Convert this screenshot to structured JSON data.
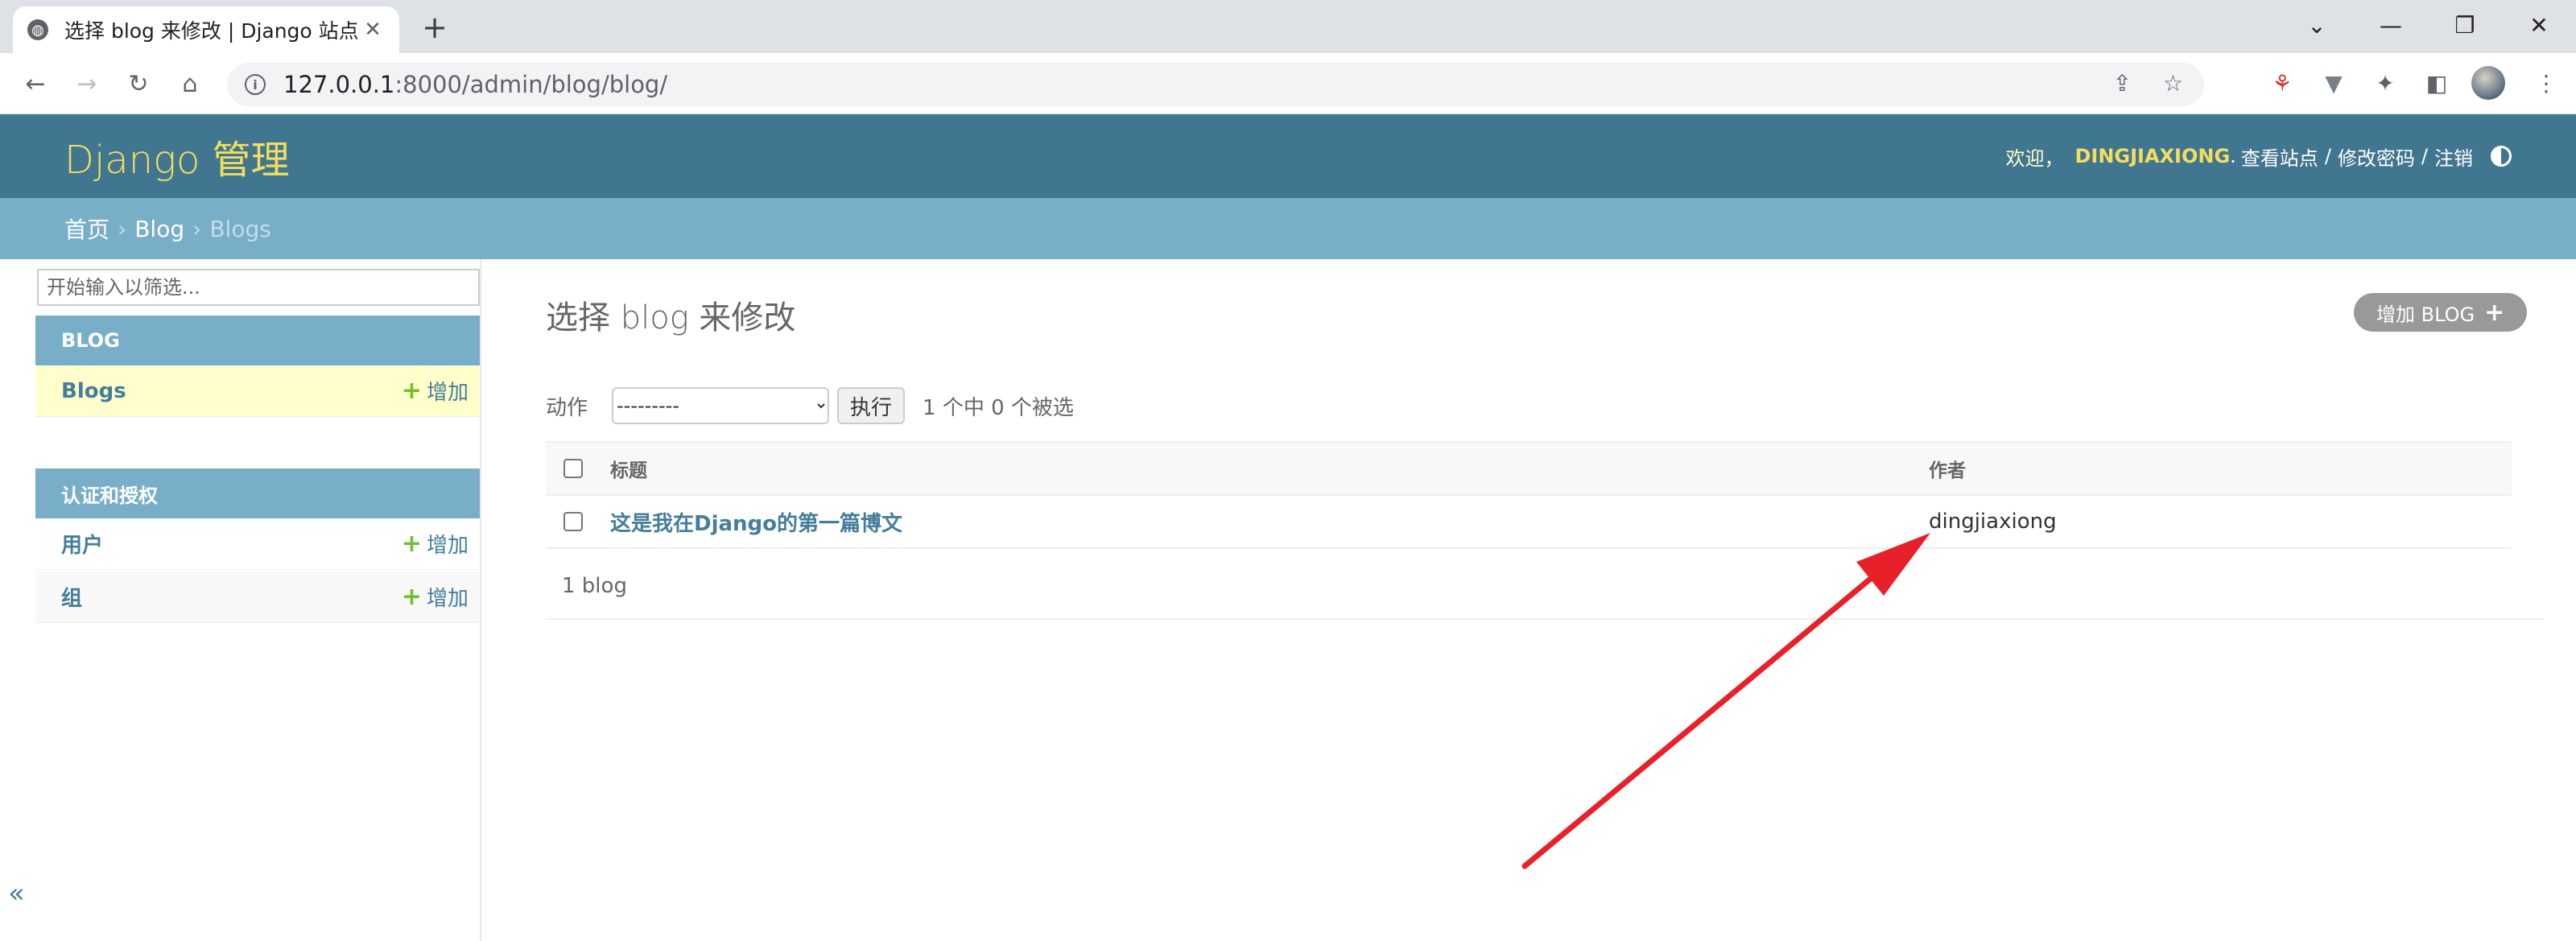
{
  "browser": {
    "tab_title": "选择 blog 来修改 | Django 站点",
    "url_host": "127.0.0.1",
    "url_path": ":8000/admin/blog/blog/"
  },
  "header": {
    "branding": "Django 管理",
    "welcome": "欢迎，",
    "username": "DINGJIAXIONG",
    "username_suffix": ".",
    "view_site": "查看站点",
    "change_password": "修改密码",
    "logout": "注销",
    "sep": "/"
  },
  "breadcrumbs": {
    "home": "首页",
    "app": "Blog",
    "current": "Blogs",
    "sep": "›"
  },
  "sidebar": {
    "filter_placeholder": "开始输入以筛选...",
    "apps": [
      {
        "caption": "BLOG",
        "models": [
          {
            "name": "Blogs",
            "add": "增加"
          }
        ]
      },
      {
        "caption": "认证和授权",
        "models": [
          {
            "name": "用户",
            "add": "增加"
          },
          {
            "name": "组",
            "add": "增加"
          }
        ]
      }
    ],
    "collapse": "«"
  },
  "content": {
    "title": "选择 blog 来修改",
    "add_button": "增加 BLOG",
    "actions_label": "动作",
    "actions_select": "---------",
    "go_button": "执行",
    "selection_count": "1 个中 0 个被选",
    "columns": [
      "标题",
      "作者"
    ],
    "rows": [
      {
        "title": "这是我在Django的第一篇博文",
        "author": "dingjiaxiong"
      }
    ],
    "paginator": "1 blog"
  },
  "annotation": {
    "arrow_color": "#e8202a"
  }
}
